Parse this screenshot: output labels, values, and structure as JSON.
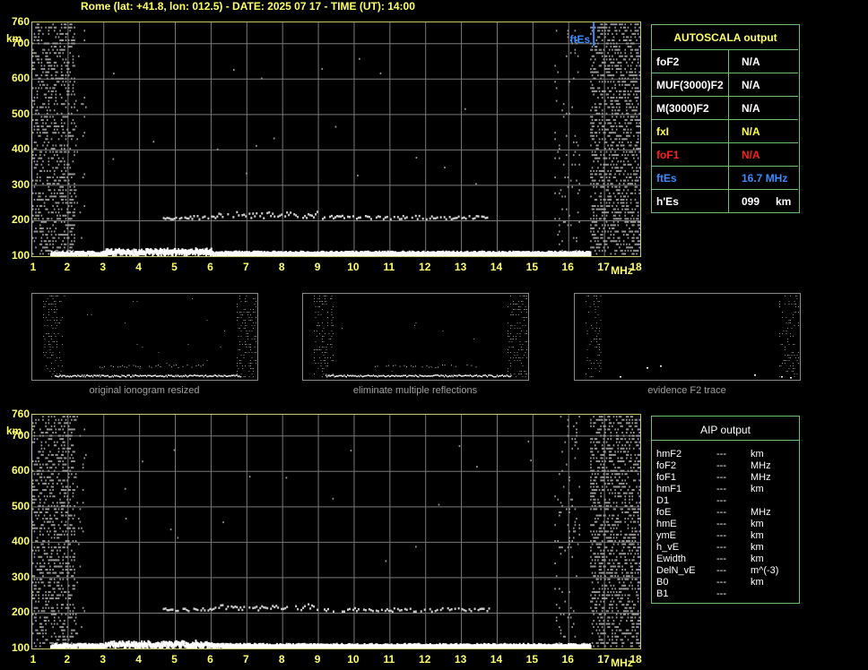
{
  "header": "Rome (lat: +41.8, lon: 012.5) - DATE: 2025 07 17 - TIME (UT): 14:00",
  "axes": {
    "y_ticks": [
      "760",
      "700",
      "600",
      "500",
      "400",
      "300",
      "200",
      "100"
    ],
    "y_unit": "km",
    "x_ticks": [
      "1",
      "2",
      "3",
      "4",
      "5",
      "6",
      "7",
      "8",
      "9",
      "10",
      "11",
      "12",
      "13",
      "14",
      "15",
      "16",
      "17",
      "18"
    ],
    "x_unit": "MHz"
  },
  "chart_data": [
    {
      "type": "scatter",
      "title": "",
      "xlabel": "MHz",
      "ylabel": "km",
      "xlim": [
        1,
        18
      ],
      "ylim": [
        100,
        760
      ],
      "grid": true,
      "series": [
        {
          "name": "",
          "trace": "E/Es echo",
          "x_range": [
            1.5,
            16.6
          ],
          "height_km": 110
        },
        {
          "name": "",
          "trace": "second-hop echo",
          "x_range": [
            4.6,
            13.8
          ],
          "height_km": 210
        }
      ],
      "annotations": [
        {
          "label": "ftEs",
          "x": 16.7
        }
      ]
    },
    {
      "type": "scatter",
      "title": "",
      "xlabel": "MHz",
      "ylabel": "km",
      "xlim": [
        1,
        18
      ],
      "ylim": [
        100,
        760
      ],
      "grid": true,
      "series": [
        {
          "name": "",
          "trace": "E/Es echo",
          "x_range": [
            1.5,
            16.6
          ],
          "height_km": 110
        },
        {
          "name": "",
          "trace": "second-hop echo",
          "x_range": [
            4.6,
            13.8
          ],
          "height_km": 210
        }
      ]
    }
  ],
  "ftes_label": "ftEs",
  "autoscala": {
    "title": "AUTOSCALA output",
    "rows": [
      {
        "k": "foF2",
        "v": "N/A",
        "u": "",
        "color": "#ffffff"
      },
      {
        "k": "MUF(3000)F2",
        "v": "N/A",
        "u": "",
        "color": "#ffffff"
      },
      {
        "k": "M(3000)F2",
        "v": "N/A",
        "u": "",
        "color": "#ffffff"
      },
      {
        "k": "fxI",
        "v": "N/A",
        "u": "",
        "color": "#ffff44"
      },
      {
        "k": "foF1",
        "v": "N/A",
        "u": "",
        "color": "#ff2020"
      },
      {
        "k": "ftEs",
        "v": "16.7 MHz",
        "u": "",
        "color": "#3a8cff"
      },
      {
        "k": "h'Es",
        "v": "099",
        "u": "km",
        "color": "#ffffff"
      }
    ]
  },
  "small_captions": [
    "original ionogram resized",
    "eliminate multiple reflections",
    "evidence F2 trace"
  ],
  "aip": {
    "title": "AIP output",
    "rows": [
      {
        "k": "hmF2",
        "v": "---",
        "u": "km"
      },
      {
        "k": "foF2",
        "v": "---",
        "u": "MHz"
      },
      {
        "k": "foF1",
        "v": "---",
        "u": "MHz"
      },
      {
        "k": "hmF1",
        "v": "---",
        "u": "km"
      },
      {
        "k": "D1",
        "v": "---",
        "u": ""
      },
      {
        "k": "foE",
        "v": "---",
        "u": "MHz"
      },
      {
        "k": "hmE",
        "v": "---",
        "u": "km"
      },
      {
        "k": "ymE",
        "v": "---",
        "u": "km"
      },
      {
        "k": "h_vE",
        "v": "---",
        "u": "km"
      },
      {
        "k": "Ewidth",
        "v": "---",
        "u": "km"
      },
      {
        "k": "DelN_vE",
        "v": "---",
        "u": "m^(-3)"
      },
      {
        "k": "B0",
        "v": "---",
        "u": "km"
      },
      {
        "k": "B1",
        "v": "---",
        "u": ""
      }
    ]
  },
  "colors": {
    "axis": "#ffff66",
    "grid": "#7a7a7a",
    "panel_border": "#6fbf6f",
    "ftes": "#3a8cff"
  }
}
